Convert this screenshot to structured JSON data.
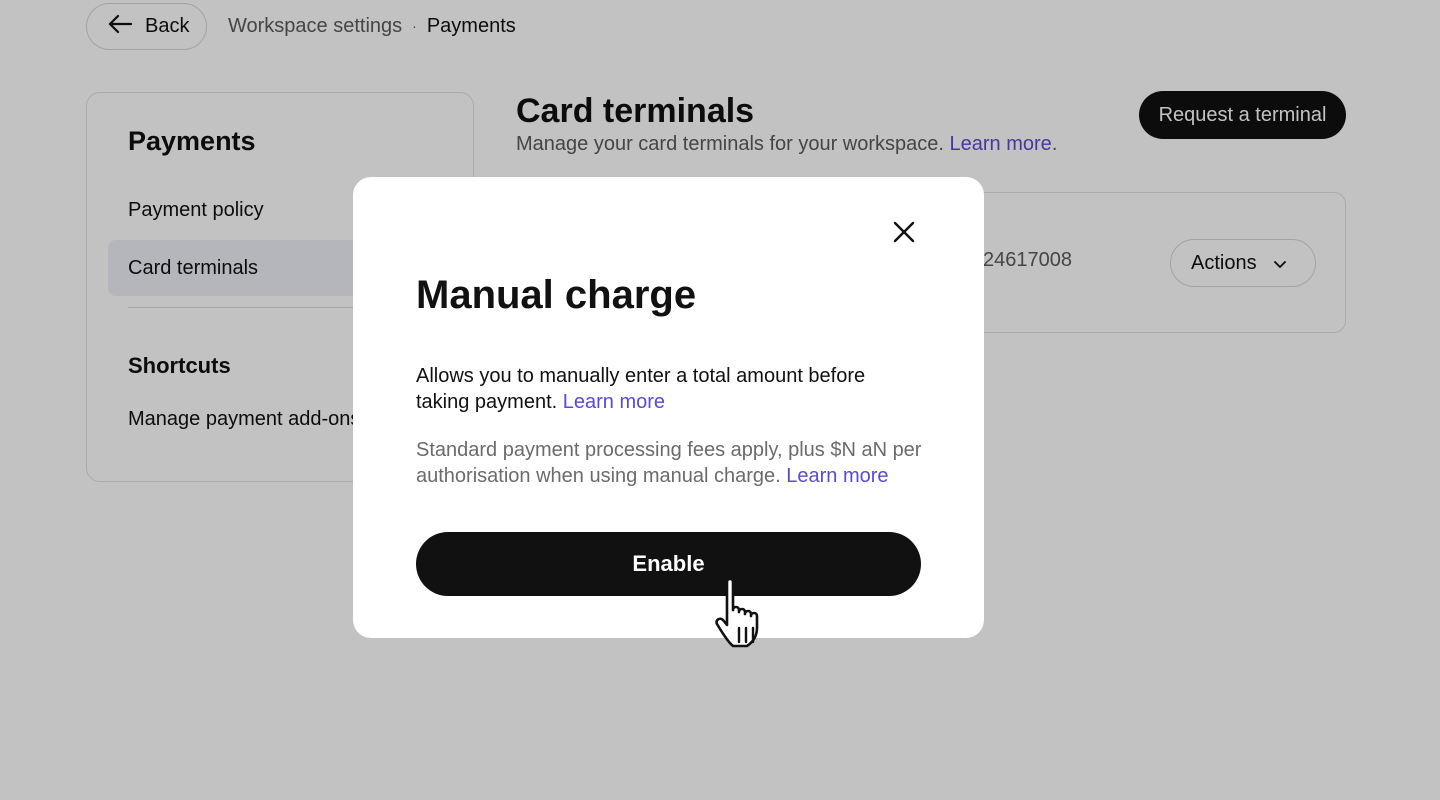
{
  "header": {
    "back_label": "Back",
    "breadcrumb_parent": "Workspace settings",
    "breadcrumb_separator": "·",
    "breadcrumb_current": "Payments"
  },
  "sidebar": {
    "title": "Payments",
    "items": [
      {
        "label": "Payment policy",
        "active": false
      },
      {
        "label": "Card terminals",
        "active": true
      }
    ],
    "shortcuts_title": "Shortcuts",
    "shortcut_link": "Manage payment add-ons"
  },
  "main": {
    "title": "Card terminals",
    "subtitle": "Manage your card terminals for your workspace.",
    "subtitle_link": "Learn more",
    "subtitle_end": ".",
    "request_button": "Request a terminal",
    "terminal": {
      "serial": "24617008",
      "actions_label": "Actions"
    }
  },
  "modal": {
    "title": "Manual charge",
    "description": "Allows you to manually enter a total amount before taking payment.",
    "description_link": "Learn more",
    "note": "Standard payment processing fees apply, plus $N aN per authorisation when using manual charge.",
    "note_link": "Learn more",
    "enable_button": "Enable"
  },
  "colors": {
    "accent_link": "#5a4bd1",
    "primary_button": "#111111",
    "active_nav": "#eef0f7"
  },
  "icons": {
    "back": "arrow-left-icon",
    "close": "close-icon",
    "actions": "chevron-down-icon",
    "cursor": "hand-pointer-icon"
  }
}
